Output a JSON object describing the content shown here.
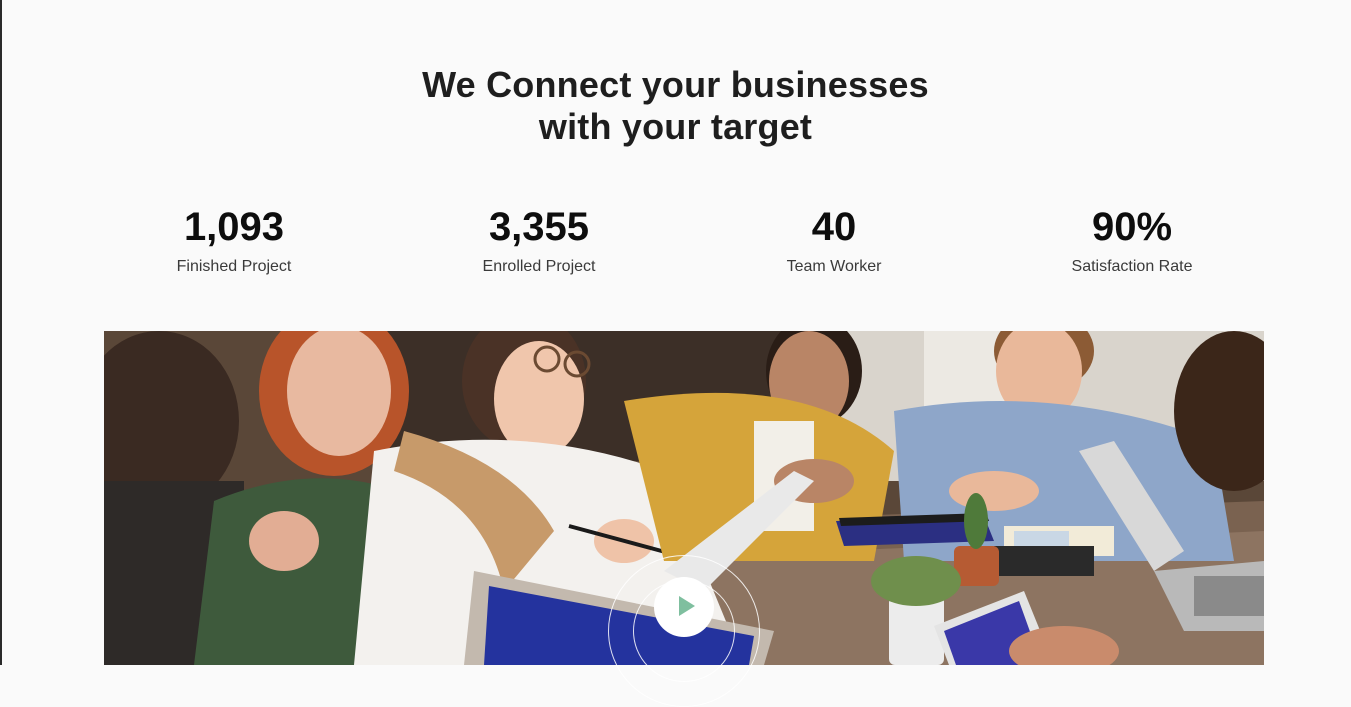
{
  "section": {
    "heading_line1": "We Connect your businesses",
    "heading_line2": "with your target"
  },
  "stats": [
    {
      "value": "1,093",
      "label": "Finished Project"
    },
    {
      "value": "3,355",
      "label": "Enrolled Project"
    },
    {
      "value": "40",
      "label": "Team Worker"
    },
    {
      "value": "90%",
      "label": "Satisfaction Rate"
    }
  ],
  "media": {
    "photo_subject": "team-meeting-photo",
    "play_icon": "play-icon",
    "accent_color": "#7fbf9f"
  }
}
